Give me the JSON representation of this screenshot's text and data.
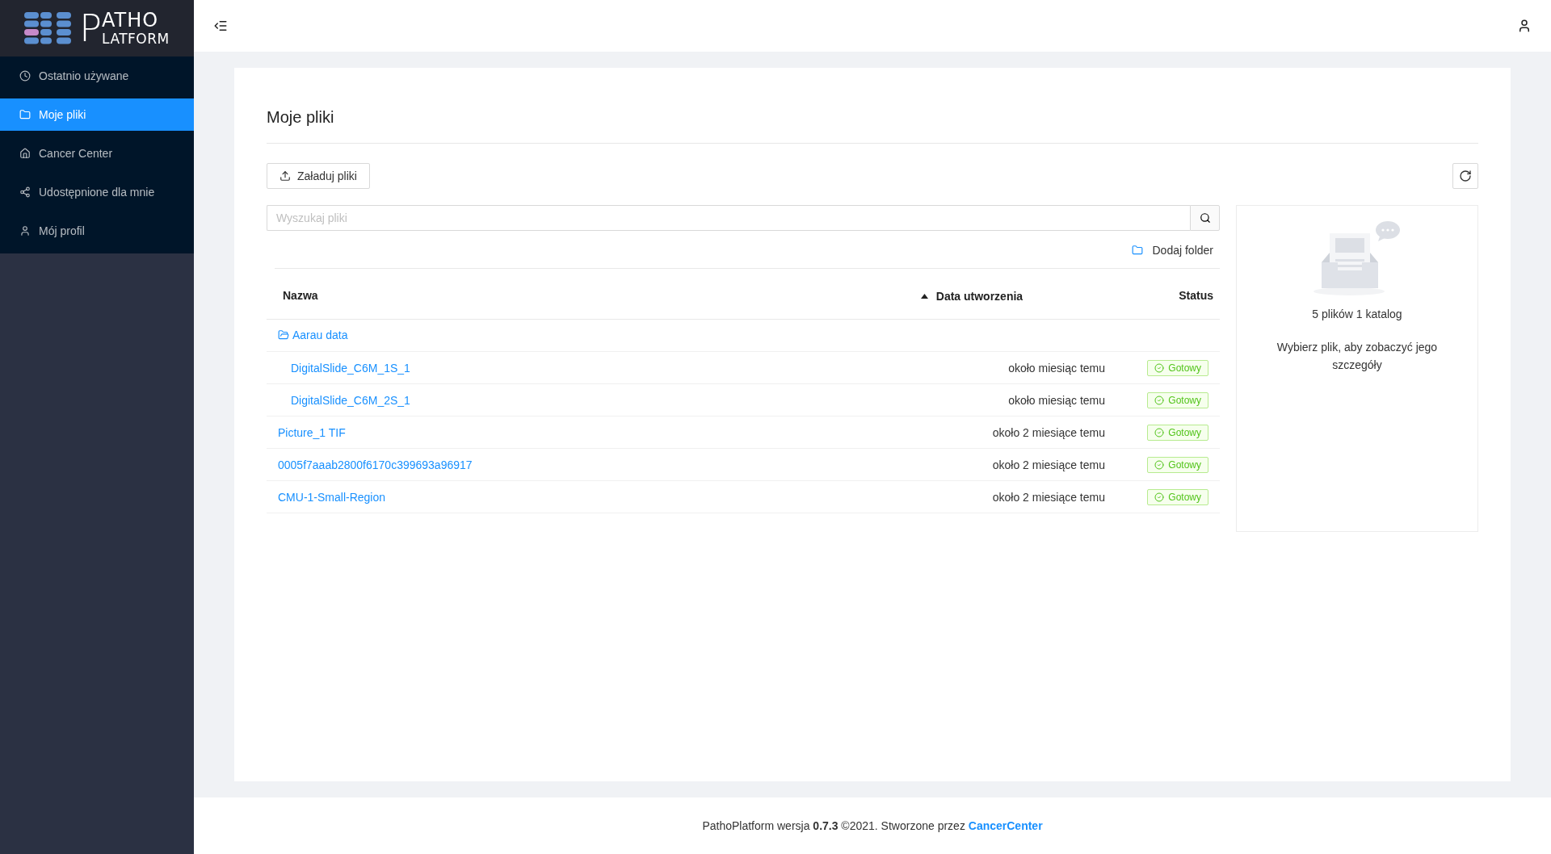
{
  "logo": {
    "initial": "P",
    "top": "ATHO",
    "bottom": "LATFORM"
  },
  "sidebar": {
    "items": [
      {
        "label": "Ostatnio używane",
        "selected": false
      },
      {
        "label": "Moje pliki",
        "selected": true
      },
      {
        "label": "Cancer Center",
        "selected": false
      },
      {
        "label": "Udostępnione dla mnie",
        "selected": false
      },
      {
        "label": "Mój profil",
        "selected": false
      }
    ]
  },
  "page": {
    "title": "Moje pliki",
    "upload_button": "Załaduj pliki",
    "search": {
      "placeholder": "Wyszukaj pliki"
    },
    "add_folder": "Dodaj folder",
    "table": {
      "columns": [
        {
          "label": "Nazwa",
          "sorted": false
        },
        {
          "label": "Data utworzenia",
          "sorted": true
        },
        {
          "label": "Status",
          "sorted": false
        }
      ],
      "rows": [
        {
          "kind": "folder",
          "name": "Aarau data",
          "children": [
            {
              "kind": "file",
              "name": "DigitalSlide_C6M_1S_1",
              "created": "około miesiąc temu",
              "status": "Gotowy"
            },
            {
              "kind": "file",
              "name": "DigitalSlide_C6M_2S_1",
              "created": "około miesiąc temu",
              "status": "Gotowy"
            }
          ]
        },
        {
          "kind": "file",
          "name": "Picture_1 TIF",
          "created": "około 2 miesiące temu",
          "status": "Gotowy"
        },
        {
          "kind": "file",
          "name": "0005f7aaab2800f6170c399693a96917",
          "created": "około 2 miesiące temu",
          "status": "Gotowy"
        },
        {
          "kind": "file",
          "name": "CMU-1-Small-Region",
          "created": "około 2 miesiące temu",
          "status": "Gotowy"
        }
      ]
    },
    "details": {
      "summary": "5 plików 1 katalog",
      "hint": "Wybierz plik, aby zobaczyć jego szczegóły"
    }
  },
  "footer": {
    "text": "PathoPlatform wersja **0.7.3** ©2021. Stworzone przez ",
    "link": "CancerCenter"
  }
}
